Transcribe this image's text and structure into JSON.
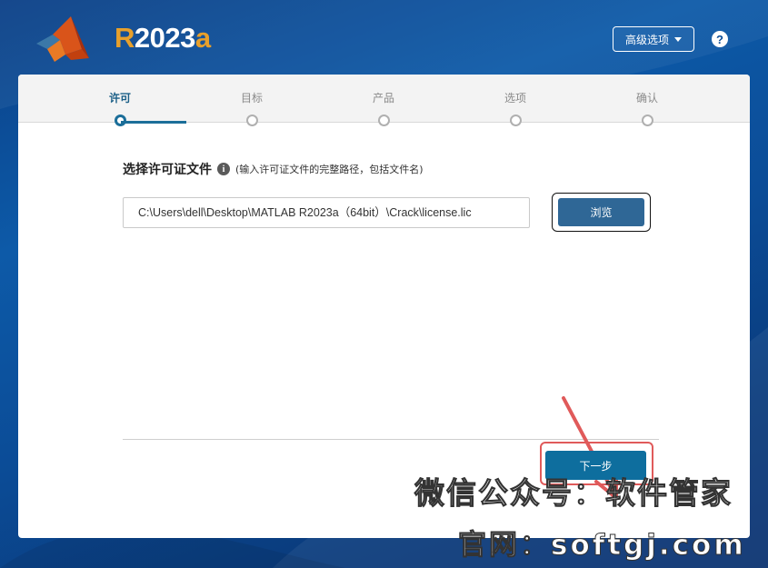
{
  "header": {
    "brand_r": "R",
    "brand_year": "2023",
    "brand_a": "a",
    "advanced_label": "高级选项",
    "help_label": "?"
  },
  "steps": [
    {
      "label": "许可",
      "active": true
    },
    {
      "label": "目标",
      "active": false
    },
    {
      "label": "产品",
      "active": false
    },
    {
      "label": "选项",
      "active": false
    },
    {
      "label": "确认",
      "active": false
    }
  ],
  "license": {
    "title": "选择许可证文件",
    "info_icon": "i",
    "hint": "(输入许可证文件的完整路径，包括文件名)",
    "path_value": "C:\\Users\\dell\\Desktop\\MATLAB R2023a（64bit）\\Crack\\license.lic",
    "browse_label": "浏览"
  },
  "footer": {
    "next_label": "下一步"
  },
  "watermark": {
    "line1": "微信公众号：软件管家",
    "line2": "官网：softgj.com"
  },
  "colors": {
    "background": "#0b4c97",
    "accent_step": "#1b6e99",
    "browse_button": "#2f6796",
    "next_button": "#0e6e9e",
    "annotation_red": "#e05a5a",
    "brand_orange": "#e8a02b"
  },
  "icons": {
    "logo": "matlab-membrane-logo",
    "caret": "caret-down-icon",
    "help": "help-circle-icon",
    "info": "info-circle-icon",
    "annotation": "red-arrow-annotation"
  }
}
